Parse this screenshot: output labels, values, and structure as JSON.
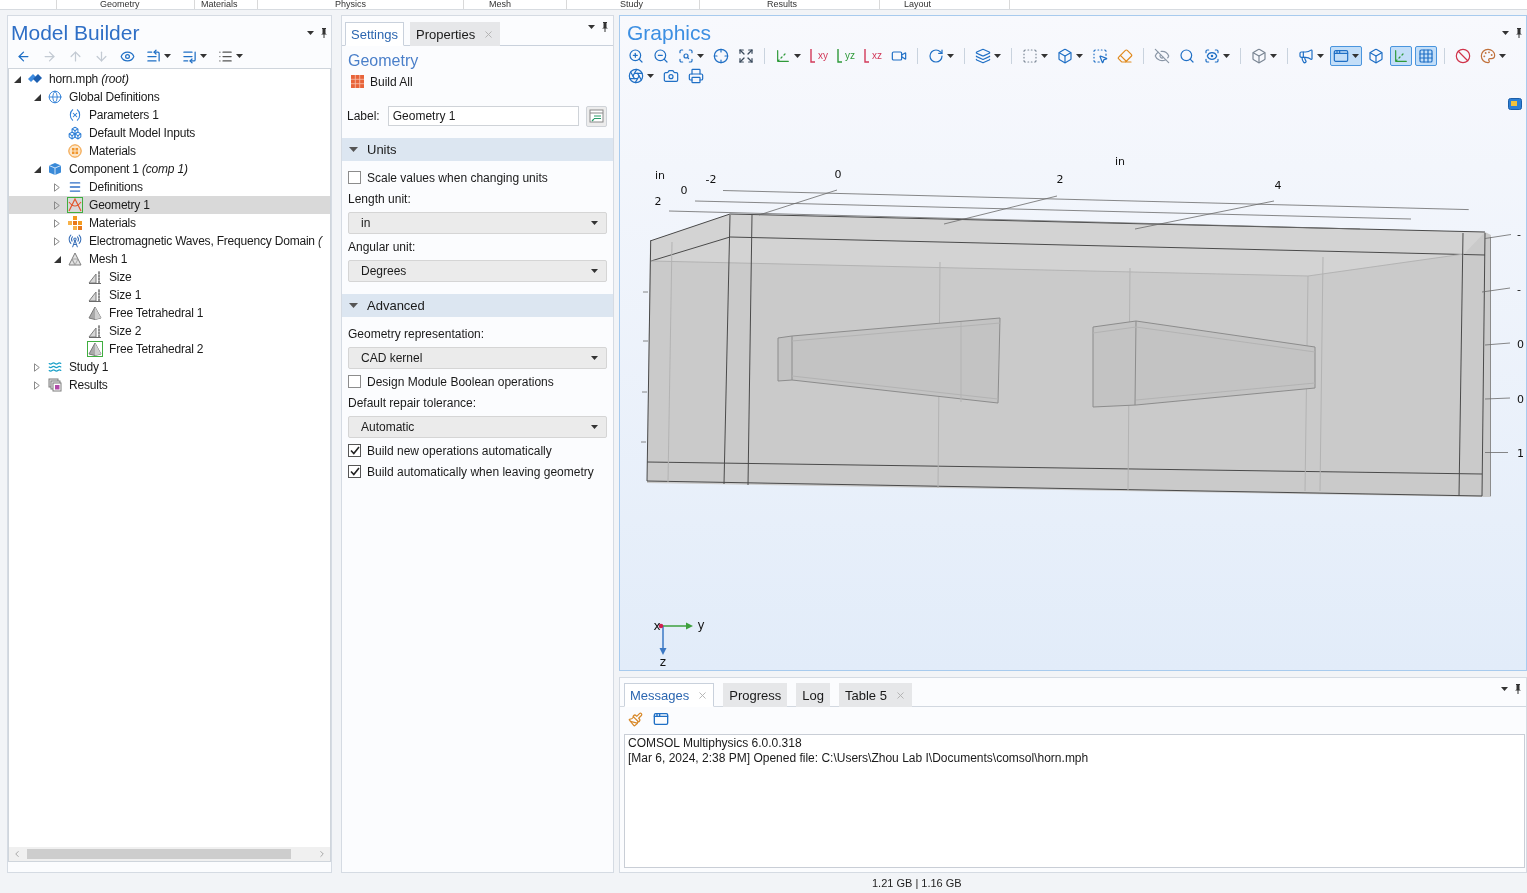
{
  "ribbon": {
    "groups": [
      "Geometry",
      "Materials",
      "Physics",
      "Mesh",
      "Study",
      "Results",
      "Layout"
    ]
  },
  "model_builder": {
    "title": "Model Builder",
    "toolbar": [
      {
        "disabled": false
      },
      {
        "disabled": true
      },
      {
        "disabled": true
      },
      {
        "disabled": true
      },
      {
        "disabled": false
      },
      {
        "disabled": false
      },
      {
        "disabled": false
      },
      {
        "disabled": false
      }
    ],
    "tree": [
      {
        "kind": "file",
        "label": "horn.mph *(root)*",
        "expanded": true,
        "selected": false,
        "current": false,
        "children": [
          {
            "kind": "globe",
            "label": "Global Definitions",
            "expanded": true,
            "selected": false,
            "current": false,
            "children": [
              {
                "kind": "parameters",
                "label": "Parameters 1",
                "selected": false,
                "current": false
              },
              {
                "kind": "inputs",
                "label": "Default Model Inputs",
                "selected": false,
                "current": false
              },
              {
                "kind": "material",
                "label": "Materials",
                "selected": false,
                "current": false
              }
            ]
          },
          {
            "kind": "component",
            "label": "Component 1 *(comp 1)*",
            "expanded": true,
            "selected": false,
            "current": false,
            "children": [
              {
                "kind": "definitions",
                "label": "Definitions",
                "expanded": false,
                "selected": false,
                "current": false
              },
              {
                "kind": "geometry",
                "label": "Geometry 1",
                "expanded": false,
                "selected": true,
                "current": true
              },
              {
                "kind": "materials",
                "label": "Materials",
                "expanded": false,
                "selected": false,
                "current": false
              },
              {
                "kind": "physics",
                "label": "Electromagnetic Waves, Frequency Domain *(*",
                "expanded": false,
                "selected": false,
                "current": false
              },
              {
                "kind": "mesh",
                "label": "Mesh 1",
                "expanded": true,
                "selected": false,
                "current": false,
                "children": [
                  {
                    "kind": "size",
                    "label": "Size",
                    "selected": false,
                    "current": false
                  },
                  {
                    "kind": "size",
                    "label": "Size 1",
                    "selected": false,
                    "current": false
                  },
                  {
                    "kind": "tetra",
                    "label": "Free Tetrahedral 1",
                    "selected": false,
                    "current": false
                  },
                  {
                    "kind": "size",
                    "label": "Size 2",
                    "selected": false,
                    "current": false
                  },
                  {
                    "kind": "tetra",
                    "label": "Free Tetrahedral 2",
                    "selected": false,
                    "current": true
                  }
                ]
              }
            ]
          },
          {
            "kind": "study",
            "label": "Study 1",
            "expanded": false,
            "selected": false,
            "current": false
          },
          {
            "kind": "results",
            "label": "Results",
            "expanded": false,
            "selected": false,
            "current": false
          }
        ]
      }
    ]
  },
  "settings": {
    "tabs": [
      {
        "label": "Settings",
        "selected": true,
        "closable": false
      },
      {
        "label": "Properties",
        "selected": false,
        "closable": true
      }
    ],
    "title": "Geometry",
    "build_button": "Build All",
    "label_field": {
      "label": "Label:",
      "value": "Geometry 1"
    },
    "sections": [
      {
        "title": "Units",
        "expanded": true,
        "items": [
          {
            "kind": "checkbox",
            "label": "Scale values when changing units",
            "checked": false
          },
          {
            "kind": "select",
            "label": "Length unit:",
            "value": "in"
          },
          {
            "kind": "select",
            "label": "Angular unit:",
            "value": "Degrees"
          }
        ]
      },
      {
        "title": "Advanced",
        "expanded": true,
        "items": [
          {
            "kind": "select",
            "label": "Geometry representation:",
            "value": "CAD kernel"
          },
          {
            "kind": "checkbox",
            "label": "Design Module Boolean operations",
            "checked": false
          },
          {
            "kind": "select",
            "label": "Default repair tolerance:",
            "value": "Automatic"
          },
          {
            "kind": "checkbox",
            "label": "Build new operations automatically",
            "checked": true
          },
          {
            "kind": "checkbox",
            "label": "Build automatically when leaving geometry",
            "checked": true
          }
        ]
      }
    ]
  },
  "graphics": {
    "title": "Graphics",
    "toolbar": [
      {
        "on": false
      },
      {
        "on": false
      },
      {
        "on": false
      },
      {
        "on": false
      },
      {
        "on": false
      },
      {
        "on": false
      },
      {
        "label": "xy",
        "on": false
      },
      {
        "label": "yz",
        "on": false
      },
      {
        "label": "xz",
        "on": false
      },
      {
        "on": false
      },
      {
        "on": false
      },
      {
        "on": false
      },
      {
        "on": false
      },
      {
        "on": false
      },
      {
        "on": false
      },
      {
        "on": false
      },
      {
        "on": false
      },
      {
        "on": false
      },
      {
        "on": false
      },
      {
        "on": false
      },
      {
        "on": false
      },
      {
        "on": true
      },
      {
        "on": false
      },
      {
        "on": true
      },
      {
        "on": true
      },
      {
        "on": false
      },
      {
        "on": false
      },
      {
        "on": false
      },
      {
        "on": false
      },
      {
        "on": false
      }
    ],
    "axis_labels": [
      "in",
      "0",
      "-2",
      "2",
      "0",
      "in",
      "2",
      "4",
      "-",
      "-",
      "0",
      "0",
      "1"
    ],
    "triad_labels": [
      "x",
      "y",
      "z"
    ]
  },
  "messages": {
    "tabs": [
      {
        "label": "Messages",
        "selected": true,
        "closable": true
      },
      {
        "label": "Progress",
        "selected": false,
        "closable": false
      },
      {
        "label": "Log",
        "selected": false,
        "closable": false
      },
      {
        "label": "Table 5",
        "selected": false,
        "closable": true
      }
    ],
    "lines": [
      "COMSOL Multiphysics 6.0.0.318",
      "[Mar 6, 2024, 2:38 PM] Opened file: C:\\Users\\Zhou Lab I\\Documents\\comsol\\horn.mph"
    ]
  },
  "status_bar": {
    "memory": "1.21 GB | 1.16 GB"
  }
}
